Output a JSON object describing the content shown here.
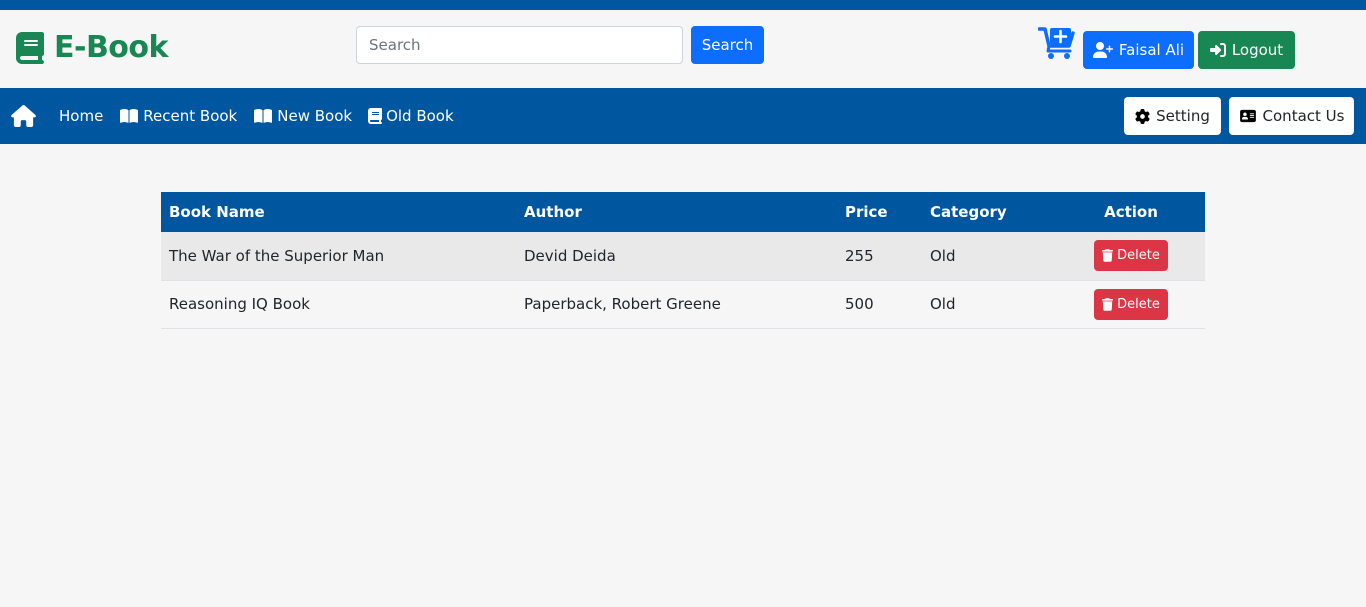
{
  "brand": {
    "name": "E-Book",
    "color": "#198754"
  },
  "search": {
    "placeholder": "Search",
    "button_label": "Search"
  },
  "header": {
    "user_label": "Faisal Ali",
    "logout_label": "Logout"
  },
  "nav": {
    "links": [
      {
        "label": "Home",
        "icon": ""
      },
      {
        "label": "Recent Book",
        "icon": "book-open-icon"
      },
      {
        "label": "New Book",
        "icon": "book-open-icon"
      },
      {
        "label": "Old Book",
        "icon": "book-icon"
      }
    ],
    "setting_label": "Setting",
    "contact_label": "Contact Us"
  },
  "table": {
    "headers": [
      "Book Name",
      "Author",
      "Price",
      "Category",
      "Action"
    ],
    "rows": [
      {
        "name": "The War of the Superior Man",
        "author": "Devid Deida",
        "price": "255",
        "category": "Old",
        "action": "Delete"
      },
      {
        "name": "Reasoning IQ Book",
        "author": "Paperback, Robert Greene",
        "price": "500",
        "category": "Old",
        "action": "Delete"
      }
    ]
  },
  "colors": {
    "primary_nav": "#00579f",
    "primary": "#0d6efd",
    "success": "#198754",
    "danger": "#dc3545"
  }
}
